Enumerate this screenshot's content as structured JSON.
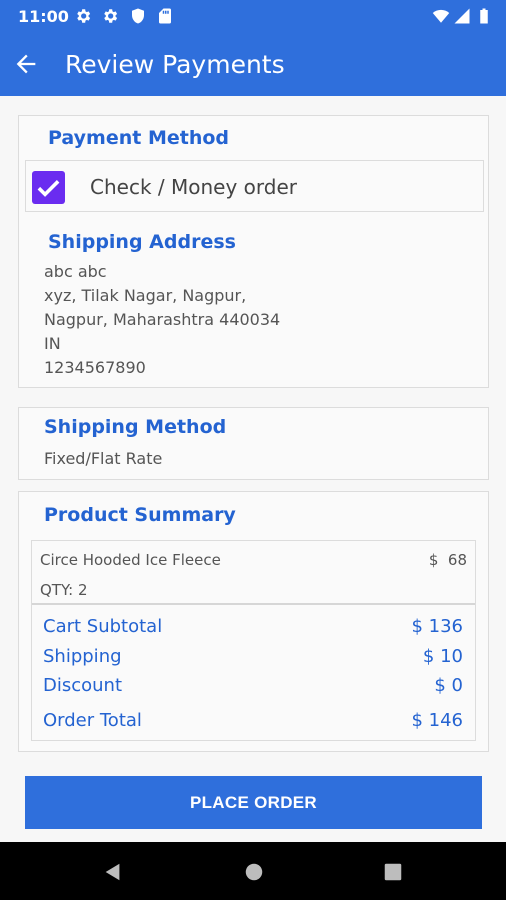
{
  "status_bar": {
    "time": "11:00",
    "icons": [
      "gear-icon",
      "gear-icon",
      "shield-icon",
      "sd-card-icon",
      "wifi-icon",
      "signal-icon",
      "battery-icon"
    ]
  },
  "app_bar": {
    "title": "Review Payments",
    "back_icon": "arrow-left-icon"
  },
  "payment_method": {
    "heading": "Payment Method",
    "option_label": "Check / Money order",
    "checked": true
  },
  "shipping_address": {
    "heading": "Shipping Address",
    "lines": [
      "abc abc",
      "xyz, Tilak Nagar, Nagpur,",
      "Nagpur, Maharashtra 440034",
      "IN",
      "1234567890"
    ]
  },
  "shipping_method": {
    "heading": "Shipping Method",
    "value": "Fixed/Flat Rate"
  },
  "product_summary": {
    "heading": "Product Summary",
    "items": [
      {
        "name": "Circe Hooded Ice Fleece",
        "price": "$  68",
        "qty": "QTY: 2"
      }
    ],
    "totals": [
      {
        "label": "Cart Subtotal",
        "value": "$ 136"
      },
      {
        "label": "Shipping",
        "value": "$ 10"
      },
      {
        "label": "Discount",
        "value": "$ 0"
      },
      {
        "label": "Order Total",
        "value": "$ 146"
      }
    ]
  },
  "place_order_label": "PLACE ORDER",
  "colors": {
    "primary": "#2f6fdc",
    "heading": "#2463d1",
    "checkbox": "#6a2cf0"
  },
  "nav_bar": {
    "icons": [
      "back-triangle-icon",
      "home-circle-icon",
      "recents-square-icon"
    ]
  }
}
